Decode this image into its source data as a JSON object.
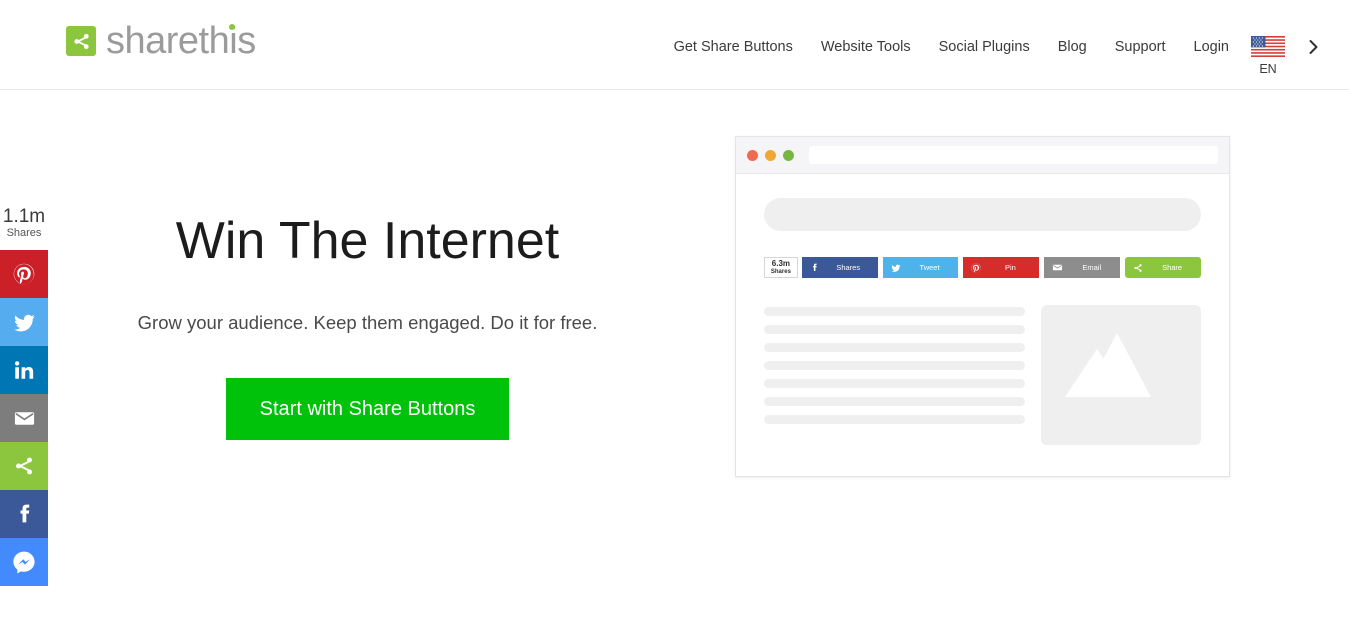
{
  "header": {
    "logo": {
      "mark_icon": "share-network-icon",
      "text": "sharethis",
      "brand_color": "#8cc63e",
      "text_color": "#9b9b9b"
    },
    "nav_links": [
      {
        "label": "Get Share Buttons"
      },
      {
        "label": "Website Tools"
      },
      {
        "label": "Social Plugins"
      },
      {
        "label": "Blog"
      },
      {
        "label": "Support"
      },
      {
        "label": "Login"
      }
    ],
    "language": {
      "code": "EN",
      "flag_icon": "us-flag-icon"
    },
    "chevron_icon": "chevron-right-icon"
  },
  "sidebar": {
    "count": {
      "value": "1.1m",
      "label": "Shares"
    },
    "buttons": [
      {
        "name": "pinterest",
        "icon": "pinterest-icon",
        "color": "#cb2027"
      },
      {
        "name": "twitter",
        "icon": "twitter-icon",
        "color": "#55acee"
      },
      {
        "name": "linkedin",
        "icon": "linkedin-icon",
        "color": "#0077b5"
      },
      {
        "name": "email",
        "icon": "email-icon",
        "color": "#7d7d7d"
      },
      {
        "name": "sharethis",
        "icon": "share-network-icon",
        "color": "#8cc63e"
      },
      {
        "name": "facebook",
        "icon": "facebook-icon",
        "color": "#3b5998"
      },
      {
        "name": "messenger",
        "icon": "messenger-icon",
        "color": "#448aff"
      }
    ]
  },
  "hero": {
    "title": "Win The Internet",
    "subtitle": "Grow your audience. Keep them engaged. Do it for free.",
    "cta_label": "Start with Share Buttons",
    "cta_color": "#00c20a"
  },
  "mockup": {
    "window_dots": [
      "#ef6a51",
      "#efa833",
      "#78b643"
    ],
    "share_counter": {
      "value": "6.3m",
      "label": "Shares"
    },
    "share_buttons": [
      {
        "name": "facebook",
        "label": "Shares",
        "icon": "facebook-icon",
        "color": "#3b5998"
      },
      {
        "name": "twitter",
        "label": "Tweet",
        "icon": "twitter-icon",
        "color": "#4eb3e8"
      },
      {
        "name": "pinterest",
        "label": "Pin",
        "icon": "pinterest-icon",
        "color": "#d62c2c"
      },
      {
        "name": "email",
        "label": "Email",
        "icon": "email-icon",
        "color": "#8d8d8d"
      },
      {
        "name": "sharethis",
        "label": "Share",
        "icon": "share-network-icon",
        "color": "#8cc63e"
      }
    ],
    "placeholder_lines": 7,
    "image_placeholder_icon": "mountains-icon"
  }
}
